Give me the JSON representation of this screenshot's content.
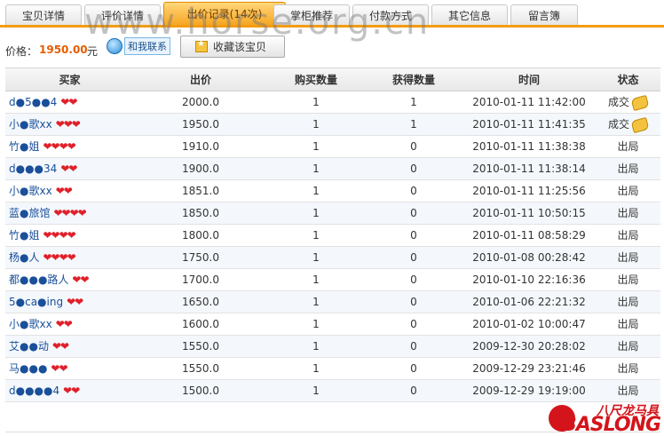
{
  "tabs": [
    {
      "label": "宝贝详情"
    },
    {
      "label": "评价详情"
    },
    {
      "label": "出价记录(14次)"
    },
    {
      "label": "掌柜推荐"
    },
    {
      "label": "付款方式"
    },
    {
      "label": "其它信息"
    },
    {
      "label": "留言簿"
    }
  ],
  "watermark": "www.horse.org.cn",
  "price": {
    "label": "价格：",
    "value": "1950.00",
    "unit": "元"
  },
  "contact_label": "和我联系",
  "favorite_label": "收藏该宝贝",
  "table": {
    "headers": [
      "买家",
      "出价",
      "购买数量",
      "获得数量",
      "时间",
      "状态"
    ],
    "rows": [
      {
        "buyer": "d●5●●4",
        "price": "2000.0",
        "qty": "1",
        "got": "1",
        "time": "2010-01-11 11:42:00",
        "status": "成交"
      },
      {
        "buyer": "小●歌xx",
        "price": "1950.0",
        "qty": "1",
        "got": "1",
        "time": "2010-01-11 11:41:35",
        "status": "成交"
      },
      {
        "buyer": "竹●姐",
        "price": "1910.0",
        "qty": "1",
        "got": "0",
        "time": "2010-01-11 11:38:38",
        "status": "出局"
      },
      {
        "buyer": "d●●●34",
        "price": "1900.0",
        "qty": "1",
        "got": "0",
        "time": "2010-01-11 11:38:14",
        "status": "出局"
      },
      {
        "buyer": "小●歌xx",
        "price": "1851.0",
        "qty": "1",
        "got": "0",
        "time": "2010-01-11 11:25:56",
        "status": "出局"
      },
      {
        "buyer": "蓝●旅馆",
        "price": "1850.0",
        "qty": "1",
        "got": "0",
        "time": "2010-01-11 10:50:15",
        "status": "出局"
      },
      {
        "buyer": "竹●姐",
        "price": "1800.0",
        "qty": "1",
        "got": "0",
        "time": "2010-01-11 08:58:29",
        "status": "出局"
      },
      {
        "buyer": "杨●人",
        "price": "1750.0",
        "qty": "1",
        "got": "0",
        "time": "2010-01-08 00:28:42",
        "status": "出局"
      },
      {
        "buyer": "都●●●路人",
        "price": "1700.0",
        "qty": "1",
        "got": "0",
        "time": "2010-01-10 22:16:36",
        "status": "出局"
      },
      {
        "buyer": "5●ca●ing",
        "price": "1650.0",
        "qty": "1",
        "got": "0",
        "time": "2010-01-06 22:21:32",
        "status": "出局"
      },
      {
        "buyer": "小●歌xx",
        "price": "1600.0",
        "qty": "1",
        "got": "0",
        "time": "2010-01-02 10:00:47",
        "status": "出局"
      },
      {
        "buyer": "艾●●动",
        "price": "1550.0",
        "qty": "1",
        "got": "0",
        "time": "2009-12-30 20:28:02",
        "status": "出局"
      },
      {
        "buyer": "马●●●",
        "price": "1550.0",
        "qty": "1",
        "got": "0",
        "time": "2009-12-29 23:21:46",
        "status": "出局"
      },
      {
        "buyer": "d●●●●4",
        "price": "1500.0",
        "qty": "1",
        "got": "0",
        "time": "2009-12-29 19:19:00",
        "status": "出局"
      }
    ]
  },
  "logo": {
    "cn": "八尺龙马具",
    "en": "BASLONG"
  },
  "colors": {
    "accent": "#f39c12",
    "price": "#e65c00",
    "link": "#1a4f9a",
    "heart": "#e0202a",
    "logo": "#d4141b"
  }
}
